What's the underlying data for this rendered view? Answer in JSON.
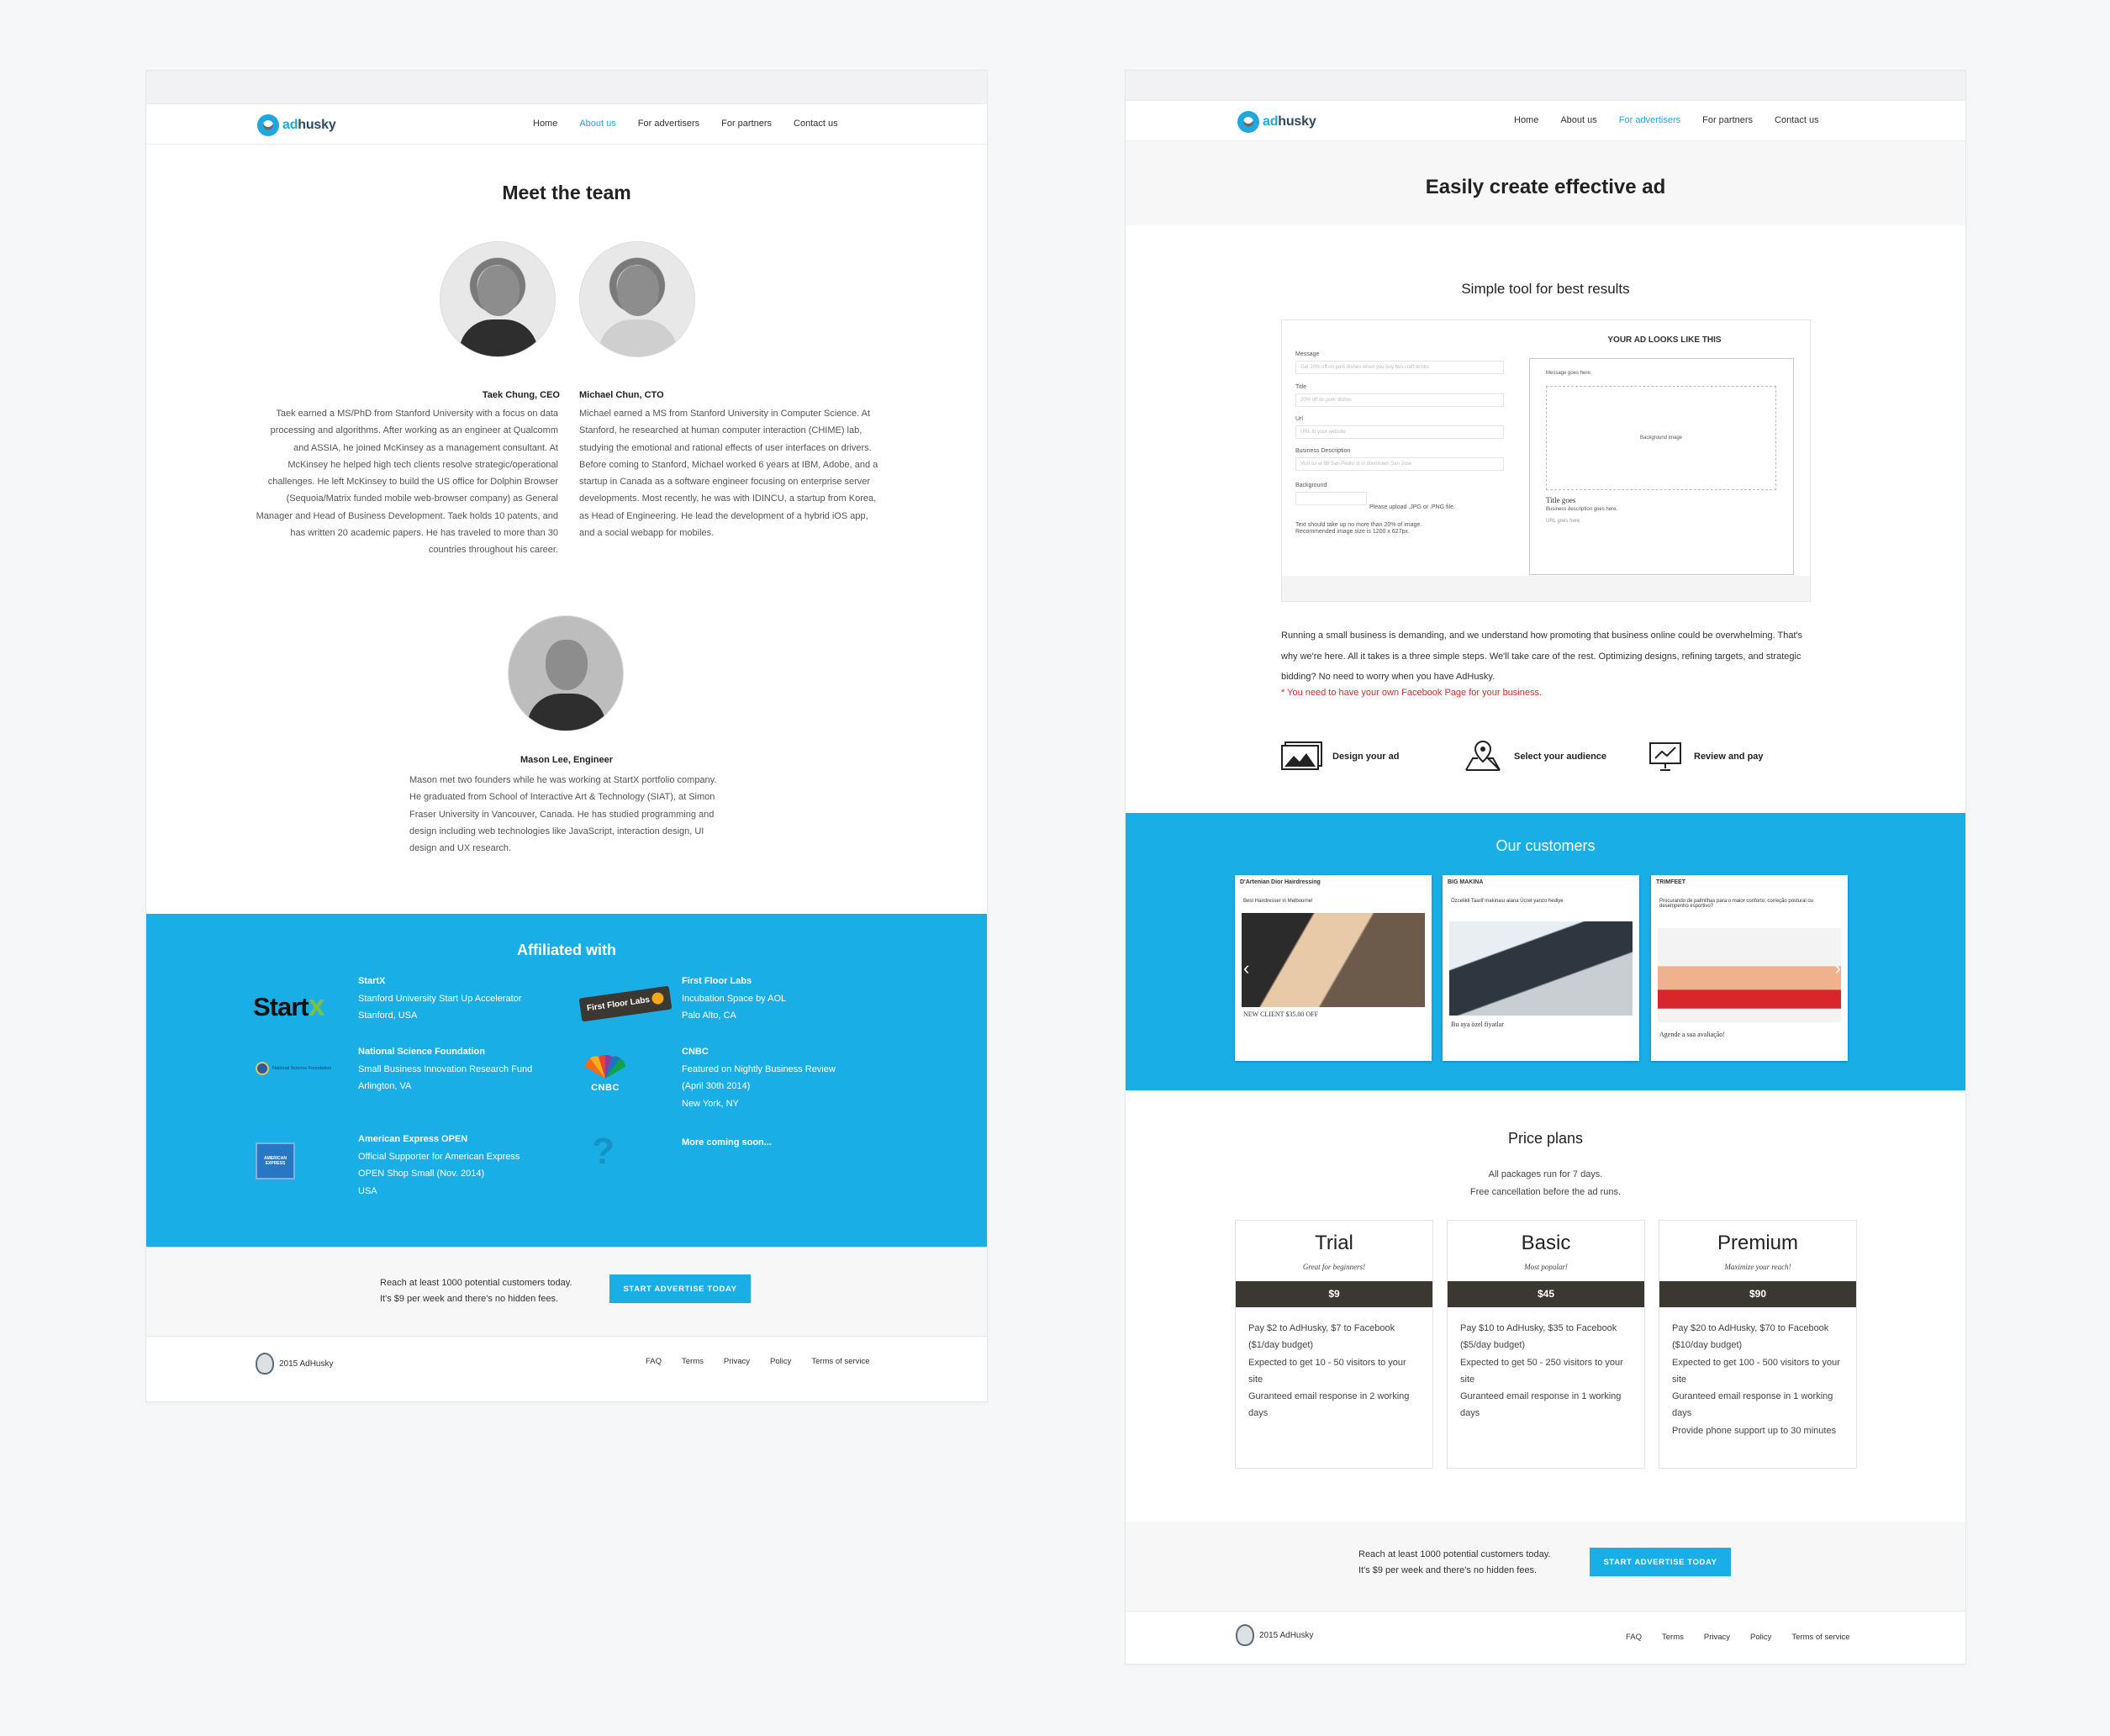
{
  "brand": {
    "name_a": "ad",
    "name_b": "husky",
    "color": "#1aaee6"
  },
  "nav": [
    "Home",
    "About us",
    "For advertisers",
    "For partners",
    "Contact us"
  ],
  "about": {
    "title": "Meet the team",
    "members": [
      {
        "name": "Taek Chung, CEO",
        "bio": "Taek earned a MS/PhD from Stanford University with a focus on data processing and algorithms. After working as an engineer at Qualcomm and ASSIA, he joined McKinsey as a management consultant. At McKinsey he helped high tech clients resolve strategic/operational challenges. He left McKinsey to build the US office for Dolphin Browser (Sequoia/Matrix funded mobile web-browser company) as General Manager and Head of Business Development. Taek holds 10 patents, and has written 20 academic papers. He has traveled to more than 30 countries throughout his career."
      },
      {
        "name": "Michael Chun, CTO",
        "bio": "Michael earned a MS from Stanford University in Computer Science.  At Stanford, he researched at human computer interaction (CHIME) lab, studying the emotional and rational effects of user interfaces on drivers.  Before coming to Stanford, Michael worked 6 years at IBM, Adobe, and a startup in Canada as a software engineer focusing on enterprise server developments.  Most recently, he was with IDINCU, a startup from Korea, as Head of Engineering.  He lead the development of a hybrid iOS app, and a social webapp for mobiles."
      },
      {
        "name": "Mason Lee, Engineer",
        "bio": "Mason met two founders while he was working at StartX portfolio company. He graduated from School of Interactive Art & Technology (SIAT), at Simon Fraser University in Vancouver, Canada. He has studied programming and design including web technologies like JavaScript, interaction design, UI design and UX research."
      }
    ],
    "affiliated_title": "Affiliated with",
    "affiliates": [
      {
        "title": "StartX",
        "l1": "Stanford University Start Up Accelerator",
        "l2": "Stanford, USA",
        "l3": "",
        "l4": "",
        "logo_text": "Start"
      },
      {
        "title": "First Floor Labs",
        "l1": "Incubation Space by AOL",
        "l2": "Palo Alto, CA",
        "l3": "",
        "l4": "",
        "logo_text": "First Floor Labs"
      },
      {
        "title": "National Science Foundation",
        "l1": "Small Business Innovation Research Fund",
        "l2": "Arlington, VA",
        "l3": "",
        "l4": "",
        "logo_text": "National Science Foundation"
      },
      {
        "title": "CNBC",
        "l1": "Featured on Nightly Business Review",
        "l2": "(April 30th 2014)",
        "l3": "New York, NY",
        "l4": "",
        "logo_text": "CNBC"
      },
      {
        "title": "American Express OPEN",
        "l1": "Official Supporter for American Express",
        "l2": "OPEN Shop Small (Nov. 2014)",
        "l3": "USA",
        "l4": "",
        "logo_text": "AMERICAN EXPRESS"
      },
      {
        "title": "More coming soon...",
        "l1": "",
        "l2": "",
        "l3": "",
        "l4": "",
        "logo_text": "?"
      }
    ]
  },
  "cta": {
    "line1": "Reach at least 1000 potential customers today.",
    "line2": "It's $9 per week and there's no hidden fees.",
    "button": "START ADVERTISE TODAY"
  },
  "footer": {
    "copyright": "2015 AdHusky",
    "links": [
      "FAQ",
      "Terms",
      "Privacy",
      "Policy",
      "Terms of service"
    ]
  },
  "advertisers": {
    "title": "Easily create effective ad",
    "tool_title": "Simple tool for best results",
    "form": {
      "fields": [
        {
          "label": "Message",
          "placeholder": "Get 20% off on pork dishes when you buy two craft drinks"
        },
        {
          "label": "Title",
          "placeholder": "20% off on pork dishes"
        },
        {
          "label": "Url",
          "placeholder": "URL to your website"
        },
        {
          "label": "Business Description",
          "placeholder": "Visit us at 88 San Pedro st in downtown San Jose"
        }
      ],
      "background_label": "Background",
      "upload_note": "Please upload .JPG or .PNG file.",
      "note1": "Text should take up no more than 20% of image.",
      "note2": "Recommended image size is 1200 x 627px."
    },
    "preview": {
      "title": "YOUR AD LOOKS LIKE THIS",
      "message": "Message goes here.",
      "image": "Background image",
      "title_goes": "Title goes",
      "desc": "Business description goes here.",
      "url": "URL goes here."
    },
    "intro": "Running a small business is demanding, and we understand how promoting that business online could be overwhelming. That's why we're here. All it takes is a three simple steps. We'll take care of the rest. Optimizing designs, refining targets, and strategic bidding? No need to worry when you have AdHusky.",
    "warning": "* You need to have your own Facebook Page for your business.",
    "steps": [
      "Design your ad",
      "Select your audience",
      "Review and pay"
    ],
    "customers_title": "Our customers",
    "customers": [
      {
        "page": "D'Artenian Dior Hairdressing",
        "text": "Best Hairdresser in Melbourne!",
        "caption": "NEW CLIENT $35.00 OFF"
      },
      {
        "page": "BIG MAKINA",
        "text": "Özcelikli Taarif makinası alana Ücret yanzo hediye",
        "caption": "Bu aya özel fiyatlar"
      },
      {
        "page": "TRIMFEET",
        "text": "Procurando de palmilhas para o maior conforto, correção postural ou desempenho esportivo?",
        "caption": "Agende a sua avaliação!"
      }
    ],
    "price_title": "Price plans",
    "price_sub1": "All packages run for 7 days.",
    "price_sub2": "Free cancellation before the ad runs.",
    "plans": [
      {
        "name": "Trial",
        "tag": "Great for beginners!",
        "price": "$9",
        "d1": "Pay $2 to AdHusky, $7 to Facebook ($1/day budget)",
        "d2": "Expected to get 10 - 50 visitors to your site",
        "d3": "Guranteed email response in 2 working days",
        "d4": ""
      },
      {
        "name": "Basic",
        "tag": "Most popular!",
        "price": "$45",
        "d1": "Pay $10 to AdHusky, $35 to Facebook ($5/day budget)",
        "d2": "Expected to get 50 - 250 visitors to your site",
        "d3": "Guranteed email response in 1 working days",
        "d4": ""
      },
      {
        "name": "Premium",
        "tag": "Maximize your reach!",
        "price": "$90",
        "d1": "Pay $20 to AdHusky, $70 to Facebook ($10/day budget)",
        "d2": "Expected to get 100 - 500 visitors to your site",
        "d3": "Guranteed email response in 1 working days",
        "d4": "Provide phone support up to 30 minutes"
      }
    ]
  }
}
